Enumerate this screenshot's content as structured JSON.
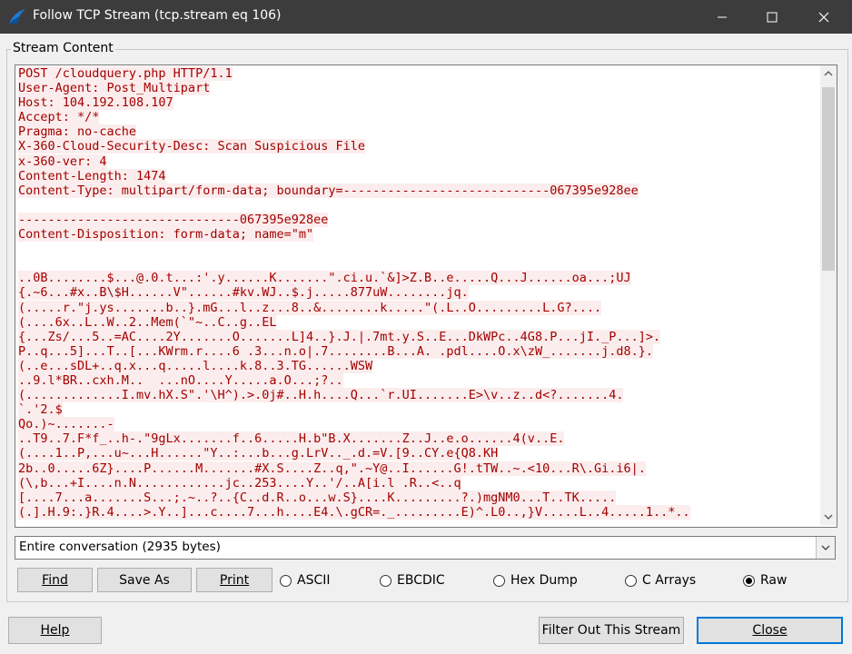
{
  "window": {
    "title": "Follow TCP Stream (tcp.stream eq 106)",
    "accent_color": "#0078d7"
  },
  "group": {
    "label": "Stream Content"
  },
  "stream": {
    "text_color": "#a40000",
    "highlight_color": "#fbeded",
    "lines": [
      "POST /cloudquery.php HTTP/1.1",
      "User-Agent: Post_Multipart",
      "Host: 104.192.108.107",
      "Accept: */*",
      "Pragma: no-cache",
      "X-360-Cloud-Security-Desc: Scan Suspicious File",
      "x-360-ver: 4",
      "Content-Length: 1474",
      "Content-Type: multipart/form-data; boundary=----------------------------067395e928ee",
      "",
      "------------------------------067395e928ee",
      "Content-Disposition: form-data; name=\"m\"",
      "",
      "",
      "..0B........$...@.0.t...:'.y......K.......\".ci.u.`&]>Z.B..e.....Q...J......oa...;UJ",
      "{.~6...#x..B\\$H......V\"......#kv.WJ..$.j.....877uW........jq.",
      "(.....r.\"j.ys.......b..}.mG...l..z...8..&........k.....\"(.L..O.........L.G?....",
      "(....6x..L..W..2..Mem(`\"~..C..g..EL",
      "{...Zs/...5..=AC....2Y.......O.......L]4..}.J.|.7mt.y.S..E...DkWPc..4G8.P...jI._P...]>.",
      "P..q...5]...T..[...KWrm.r....6 .3...n.o|.7........B...A. .pdl....O.x\\zW_.......j.d8.}.",
      "(..e...sDL+..q.x...q.....l....k.8..3.TG......WSW",
      "..9.l*BR..cxh.M..  ...nO....Y.....a.O...;?..",
      "(.............I.mv.hX.S\".'\\H^).>.0j#..H.h....Q...`r.UI.......E>\\v..z..d<?.......4.",
      "`.'2.$",
      "Qo.)~.......-",
      "..T9..7.F*f_..h-.\"9gLx.......f..6.....H.b\"B.X.......Z..J..e.o......4(v..E.",
      "(....1..P,...u~...H......\"Y..:...b...g.LrV.._.d.=V.[9..CY.e{Q8.KH",
      "2b..0.....6Z}....P......M.......#X.S....Z..q,\".~Y@..I......G!.tTW..~.<10...R\\.Gi.i6|.",
      "(\\,b...+I....n.N............jc..253....Y..'/..A[i.l .R..<..q",
      "[....7...a.......S...;.~..?..{C..d.R..o...w.S}....K.........?.)mgNM0...T..TK.....",
      "(.].H.9:.}R.4....>.Y..]...c....7...h....E4.\\.gCR=._.........E)^.L0..,}V.....L..4.....1..*.."
    ]
  },
  "conversation_select": {
    "value": "Entire conversation (2935 bytes)"
  },
  "buttons": {
    "find": "Find",
    "save_as": "Save As",
    "print": "Print",
    "help": "Help",
    "filter_out": "Filter Out This Stream",
    "close": "Close"
  },
  "formats": [
    {
      "label": "ASCII",
      "selected": false
    },
    {
      "label": "EBCDIC",
      "selected": false
    },
    {
      "label": "Hex Dump",
      "selected": false
    },
    {
      "label": "C Arrays",
      "selected": false
    },
    {
      "label": "Raw",
      "selected": true
    }
  ]
}
